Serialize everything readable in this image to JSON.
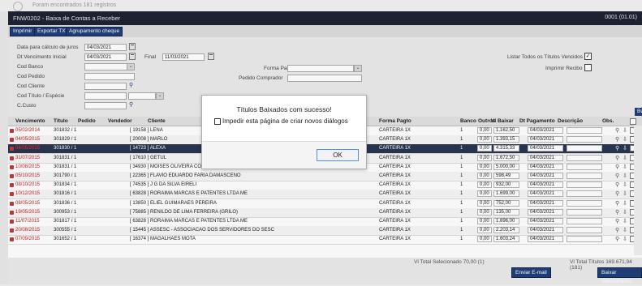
{
  "top_strip": {
    "text": "Foram encontrados 181 registros"
  },
  "window": {
    "title": "FNW0202 - Baixa de Contas a Receber",
    "code": "0001 (01.01)"
  },
  "toolbar": {
    "buttons": [
      "Imprimir",
      "Exportar TXT",
      "Agrupamento cheque"
    ]
  },
  "filters": {
    "data_calculo_label": "Data para cálculo de juros",
    "data_calculo_value": "04/03/2021",
    "dt_venc_inicial_label": "Dt Vencimento Inicial",
    "dt_venc_inicial_value": "04/03/2021",
    "final_label": "Final",
    "final_value": "11/03/2021",
    "cod_banco_label": "Cod Banco",
    "cod_pedido_label": "Cod Pedido",
    "cod_cliente_label": "Cod Cliente",
    "cod_titulo_label": "Cod Título / Espécie",
    "c_custo_label": "C.Custo",
    "forma_pagto_label": "Forma Pagto",
    "pedido_comprador_label": "Pedido Comprador",
    "listar_todos_label": "Listar Todos os Títulos Vencidos",
    "imprimir_recibo_label": "Imprimir Recibo",
    "listar_todos_checked": "✓"
  },
  "buscar_label": "Buscar",
  "grid": {
    "headers": [
      "Vencimento",
      "Título",
      "Pedido",
      "Vendedor",
      "Cliente",
      "Forma Pagto",
      "Banco",
      "Outros",
      "Vl Baixar",
      "Dt Pagamento",
      "Descrição",
      "Obs."
    ],
    "rows": [
      {
        "venc": "05/02/2014",
        "titulo": "301832 / 1",
        "cliente": "[ 19158 ]  LENA",
        "forma": "CARTEIRA 1X",
        "banco": "1",
        "outros": "0,00",
        "vl": "1.162,50",
        "dt": "04/03/2021"
      },
      {
        "venc": "04/05/2015",
        "titulo": "301829 / 1",
        "cliente": "[ 20008 ]  MARLO",
        "forma": "CARTEIRA 1X",
        "banco": "1",
        "outros": "0,00",
        "vl": "1.393,15",
        "dt": "04/03/2021"
      },
      {
        "venc": "04/05/2015",
        "titulo": "301830 / 1",
        "cliente": "[ 14723 ]  ALEXA",
        "forma": "CARTEIRA 1X",
        "banco": "1",
        "outros": "0,00",
        "vl": "4.315,33",
        "dt": "04/03/2021"
      },
      {
        "venc": "31/07/2015",
        "titulo": "301831 / 1",
        "cliente": "[ 17610 ]  GETUL",
        "forma": "CARTEIRA 1X",
        "banco": "1",
        "outros": "0,00",
        "vl": "1.672,50",
        "dt": "04/03/2021"
      },
      {
        "venc": "10/08/2015",
        "titulo": "301831 / 1",
        "cliente": "[ 34930 ]  MOISES OLIVEIRA COSTA",
        "forma": "CARTEIRA 1X",
        "banco": "1",
        "outros": "0,00",
        "vl": "5.000,00",
        "dt": "04/03/2021"
      },
      {
        "venc": "05/10/2015",
        "titulo": "301790 / 1",
        "cliente": "[ 22365 ]  FLAVIO EDUARDO FARIA DAMASCENO",
        "forma": "CARTEIRA 1X",
        "banco": "1",
        "outros": "0,00",
        "vl": "598,49",
        "dt": "04/03/2021"
      },
      {
        "venc": "08/10/2015",
        "titulo": "301834 / 1",
        "cliente": "[ 74535 ]  J G DA SILVA EIRELI",
        "forma": "CARTEIRA 1X",
        "banco": "1",
        "outros": "0,00",
        "vl": "932,00",
        "dt": "04/03/2021"
      },
      {
        "venc": "10/12/2015",
        "titulo": "301816 / 1",
        "cliente": "[ 63828 ]  RORAIMA MARCAS E PATENTES LTDA ME",
        "forma": "CARTEIRA 1X",
        "banco": "1",
        "outros": "0,00",
        "vl": "1.699,00",
        "dt": "04/03/2021"
      },
      {
        "venc": "08/05/2015",
        "titulo": "301836 / 1",
        "cliente": "[ 13850 ]  ELIEL GUIMARAES PEREIRA",
        "forma": "CARTEIRA 1X",
        "banco": "1",
        "outros": "0,00",
        "vl": "752,00",
        "dt": "04/03/2021"
      },
      {
        "venc": "19/05/2015",
        "titulo": "300953 / 1",
        "cliente": "[ 75885 ]  RENILDO DE LIMA FERREIRA (GRILO)",
        "forma": "CARTEIRA 1X",
        "banco": "1",
        "outros": "0,00",
        "vl": "135,00",
        "dt": "04/03/2021"
      },
      {
        "venc": "11/07/2015",
        "titulo": "301817 / 1",
        "cliente": "[ 63828 ]  RORAIMA MARCAS E PATENTES LTDA ME",
        "forma": "CARTEIRA 1X",
        "banco": "1",
        "outros": "0,00",
        "vl": "1.696,00",
        "dt": "04/03/2021"
      },
      {
        "venc": "20/08/2015",
        "titulo": "300555 / 1",
        "cliente": "[ 15445 ]  ASSESC - ASSOCIACAO DOS SERVIDORES DO SESC",
        "forma": "CARTEIRA 1X",
        "banco": "1",
        "outros": "0,00",
        "vl": "2.203,14",
        "dt": "04/03/2021"
      },
      {
        "venc": "07/09/2015",
        "titulo": "301652 / 1",
        "cliente": "[ 16374 ]  MAGALHAES MOTA",
        "forma": "CARTEIRA 1X",
        "banco": "1",
        "outros": "0,00",
        "vl": "1.603,24",
        "dt": "04/03/2021"
      }
    ]
  },
  "footer": {
    "vl_total_selecionado": "Vl Total Selecionado 70,00  (1)",
    "vl_total_titulos": "Vl Total Títulos 169.671,94  (181)",
    "enviar_email": "Enviar E-mail",
    "baixar_selecionados": "Baixar selecionados"
  },
  "dialog": {
    "message": "Títulos Baixados com sucesso!",
    "checkbox_label": "Impedir esta página de criar novos diálogos",
    "ok": "OK"
  }
}
